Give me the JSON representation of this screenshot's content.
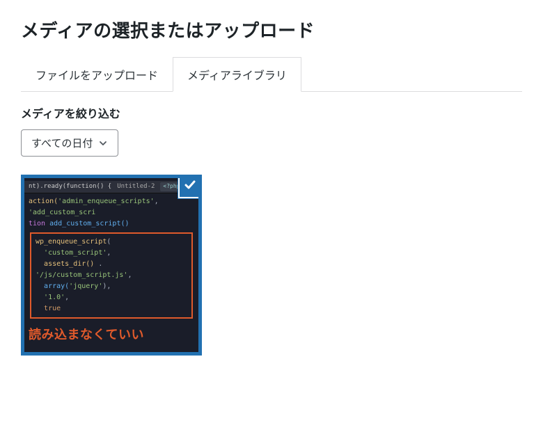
{
  "modal": {
    "title": "メディアの選択またはアップロード"
  },
  "tabs": {
    "upload": "ファイルをアップロード",
    "library": "メディアライブラリ"
  },
  "filter": {
    "label": "メディアを絞り込む",
    "date_selected": "すべての日付"
  },
  "thumb": {
    "topbar_fn": "nt).ready(function() {",
    "topbar_tab": "Untitled-2",
    "topbar_lang": "<?php",
    "line1a": "action(",
    "line1b": "'admin_enqueue_scripts'",
    "line1c": ", ",
    "line1d": "'add_custom_scri",
    "line2a": "tion",
    "line2b": " add_custom_script()",
    "box_fn": "wp_enqueue_script",
    "box_arg1": "'custom_script'",
    "box_arg2a": "assets_dir()",
    "box_arg2b": " . ",
    "box_arg2c": "'/js/custom_script.js'",
    "box_arg3a": "array(",
    "box_arg3b": "'jquery'",
    "box_arg3c": ")",
    "box_arg4": "'1.0'",
    "box_arg5": "true",
    "caption": "読み込まなくていい"
  }
}
